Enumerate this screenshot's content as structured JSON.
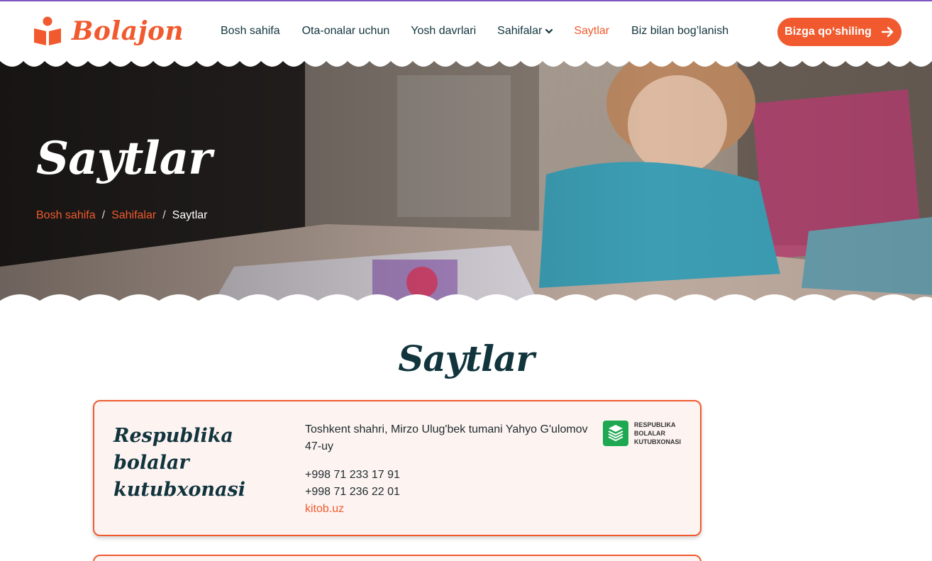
{
  "header": {
    "logo_text": "Bolajon",
    "nav": [
      {
        "label": "Bosh sahifa"
      },
      {
        "label": "Ota-onalar uchun"
      },
      {
        "label": "Yosh davrlari"
      },
      {
        "label": "Sahifalar"
      },
      {
        "label": "Saytlar",
        "active": true
      },
      {
        "label": "Biz bilan bog’lanish"
      }
    ],
    "cta_label": "Bizga qo‘shiling"
  },
  "hero": {
    "title": "Saytlar",
    "breadcrumb": {
      "items": [
        "Bosh sahifa",
        "Sahifalar"
      ],
      "separator": "/",
      "current": "Saytlar"
    }
  },
  "main": {
    "title": "Saytlar",
    "cards": [
      {
        "name": "Respublika bolalar kutubxonasi",
        "address": "Toshkent shahri, Mirzo Ulug'bek tumani Yahyo G'ulomov 47-uy",
        "phones": [
          "+998 71 233 17 91",
          "+998 71 236 22 01"
        ],
        "website": "kitob.uz",
        "logo_text": [
          "RESPUBLIKA",
          "BOLALAR",
          "KUTUBXONASI"
        ]
      }
    ]
  },
  "colors": {
    "accent": "#f05a2e",
    "dark_text": "#11343d",
    "card_bg": "#fdf3f1",
    "top_line": "#7e57c2",
    "logo_green": "#1da851"
  },
  "icons": [
    "book-reader-logo-icon",
    "chevron-down-icon",
    "arrow-right-icon",
    "library-logo-icon"
  ]
}
